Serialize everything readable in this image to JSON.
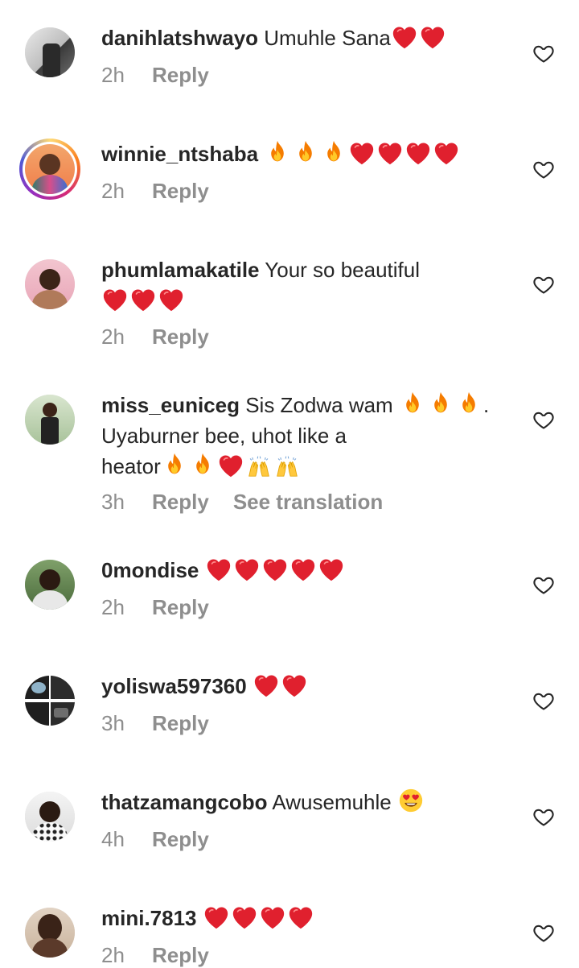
{
  "comments": [
    {
      "username": "danihlatshwayo",
      "text": "Umuhle Sana",
      "emojis_after": [
        "heart",
        "heart"
      ],
      "time": "2h",
      "reply": "Reply"
    },
    {
      "username": "winnie_ntshaba",
      "text": "",
      "emojis_after": [
        "fire",
        "fire",
        "fire",
        "heart",
        "heart",
        "heart",
        "heart"
      ],
      "time": "2h",
      "reply": "Reply"
    },
    {
      "username": "phumlamakatile",
      "text": "Your so beautiful",
      "emojis_line2": [
        "heart",
        "heart",
        "heart"
      ],
      "time": "2h",
      "reply": "Reply"
    },
    {
      "username": "miss_euniceg",
      "text": "Sis Zodwa wam",
      "text_line2": "Uyaburner bee, uhot like a",
      "text_line3": "heator",
      "emojis_line1": [
        "fire",
        "fire",
        "fire"
      ],
      "line1_suffix": ".",
      "emojis_line3": [
        "fire",
        "fire",
        "heart",
        "raising-hands",
        "raising-hands"
      ],
      "time": "3h",
      "reply": "Reply",
      "see_translation": "See translation"
    },
    {
      "username": "0mondise",
      "text": "",
      "emojis_after": [
        "heart",
        "heart",
        "heart",
        "heart",
        "heart"
      ],
      "time": "2h",
      "reply": "Reply"
    },
    {
      "username": "yoliswa597360",
      "text": "",
      "emojis_after": [
        "heart",
        "heart"
      ],
      "time": "3h",
      "reply": "Reply"
    },
    {
      "username": "thatzamangcobo",
      "text": "Awusemuhle",
      "emojis_after": [
        "heart-eyes"
      ],
      "time": "4h",
      "reply": "Reply"
    },
    {
      "username": "mini.7813",
      "text": "",
      "emojis_after": [
        "heart",
        "heart",
        "heart",
        "heart"
      ],
      "time": "2h",
      "reply": "Reply"
    }
  ],
  "colors": {
    "text": "#262626",
    "meta": "#8e8e8e",
    "heart_emoji": "#e0202e",
    "fire_emoji": "#f57c00"
  },
  "icons": {
    "like": "heart-outline-icon"
  }
}
